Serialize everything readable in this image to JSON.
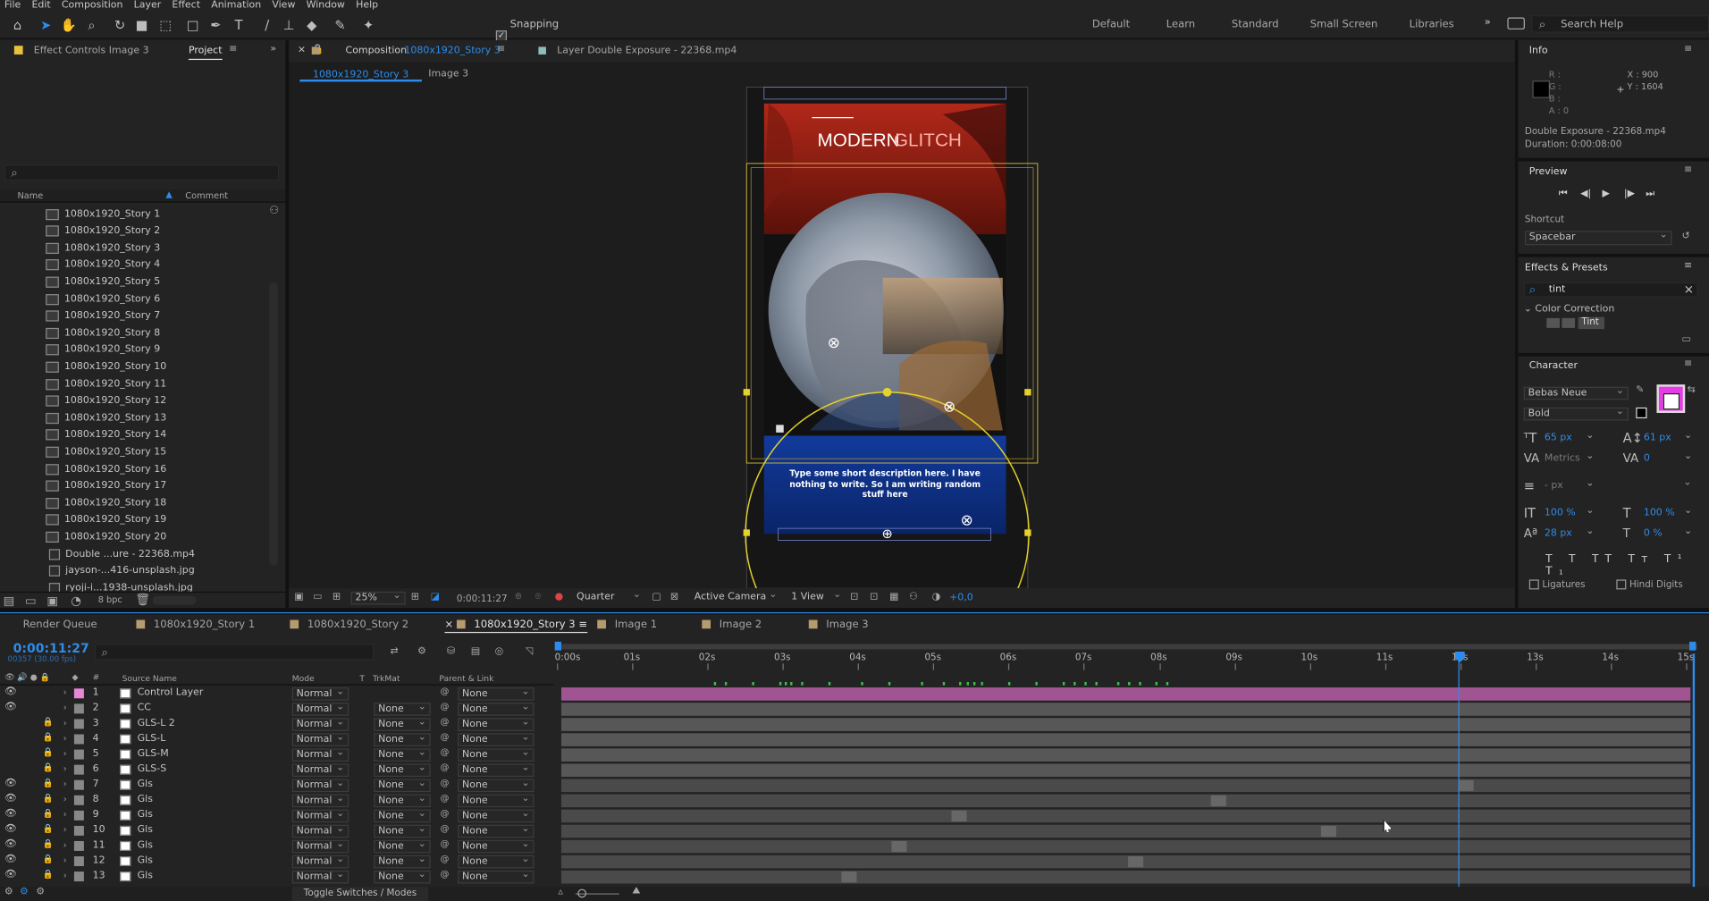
{
  "menu": [
    "File",
    "Edit",
    "Composition",
    "Layer",
    "Effect",
    "Animation",
    "View",
    "Window",
    "Help"
  ],
  "toolbar": {
    "snapping_label": "Snapping",
    "workspaces": [
      "Default",
      "Learn",
      "Standard",
      "Small Screen",
      "Libraries"
    ],
    "search_placeholder": "Search Help"
  },
  "left_panel": {
    "tab_effect_controls": "Effect Controls Image 3",
    "tab_project": "Project",
    "col_name": "Name",
    "col_comment": "Comment",
    "items": [
      "1080x1920_Story 1",
      "1080x1920_Story 2",
      "1080x1920_Story 3",
      "1080x1920_Story 4",
      "1080x1920_Story 5",
      "1080x1920_Story 6",
      "1080x1920_Story 7",
      "1080x1920_Story 8",
      "1080x1920_Story 9",
      "1080x1920_Story 10",
      "1080x1920_Story 11",
      "1080x1920_Story 12",
      "1080x1920_Story 13",
      "1080x1920_Story 14",
      "1080x1920_Story 15",
      "1080x1920_Story 16",
      "1080x1920_Story 17",
      "1080x1920_Story 18",
      "1080x1920_Story 19",
      "1080x1920_Story 20"
    ],
    "files": [
      "Double ...ure - 22368.mp4",
      "jayson-...416-unsplash.jpg",
      "ryoji-i...1938-unsplash.jpg"
    ],
    "bpc": "8 bpc"
  },
  "composition": {
    "tab_prefix": "Composition",
    "tab_name": "1080x1920_Story 3",
    "layer_tab": "Layer  Double Exposure - 22368.mp4",
    "breadcrumb_1": "1080x1920_Story 3",
    "breadcrumb_2": "Image 3",
    "title_left": "MODERN",
    "title_right": "GLITCH",
    "description": "Type some short description here. I have nothing to write. So I am writing random stuff here",
    "zoom": "25%",
    "timecode": "0:00:11:27",
    "resolution": "Quarter",
    "camera": "Active Camera",
    "views": "1 View",
    "exposure": "+0,0"
  },
  "info": {
    "title": "Info",
    "r": "R :",
    "g": "G :",
    "b": "B :",
    "a": "A :  0",
    "x": "X : 900",
    "y": "Y : 1604",
    "file": "Double Exposure - 22368.mp4",
    "duration": "Duration: 0:00:08:00"
  },
  "preview": {
    "title": "Preview",
    "shortcut_label": "Shortcut",
    "shortcut_value": "Spacebar"
  },
  "effects": {
    "title": "Effects & Presets",
    "search": "tint",
    "category": "Color Correction",
    "item": "Tint"
  },
  "character": {
    "title": "Character",
    "font": "Bebas Neue",
    "style": "Bold",
    "size": "65 px",
    "leading": "61 px",
    "kerning": "Metrics",
    "tracking": "0",
    "stroke": "- px",
    "vscale": "100 %",
    "hscale": "100 %",
    "baseline": "28 px",
    "tsume": "0 %",
    "ligatures": "Ligatures",
    "hindi": "Hindi Digits",
    "fill_color": "#e63ce6"
  },
  "timeline": {
    "tabs": [
      "Render Queue",
      "1080x1920_Story 1",
      "1080x1920_Story 2",
      "1080x1920_Story 3",
      "Image 1",
      "Image 2",
      "Image 3"
    ],
    "timecode": "0:00:11:27",
    "frames": "00357 (30.00 fps)",
    "col_source": "Source Name",
    "col_mode": "Mode",
    "col_t": "T",
    "col_trkmat": "TrkMat",
    "col_parent": "Parent & Link",
    "ruler": [
      "0:00s",
      "01s",
      "02s",
      "03s",
      "04s",
      "05s",
      "06s",
      "07s",
      "08s",
      "09s",
      "10s",
      "11s",
      "12s",
      "13s",
      "14s",
      "15s"
    ],
    "layers": [
      {
        "num": "1",
        "name": "Control Layer",
        "mode": "Normal",
        "trk": "",
        "parent": "None",
        "color": "#e887d6"
      },
      {
        "num": "2",
        "name": "CC",
        "mode": "Normal",
        "trk": "None",
        "parent": "None",
        "color": "#888888"
      },
      {
        "num": "3",
        "name": "GLS-L 2",
        "mode": "Normal",
        "trk": "None",
        "parent": "None",
        "color": "#888888"
      },
      {
        "num": "4",
        "name": "GLS-L",
        "mode": "Normal",
        "trk": "None",
        "parent": "None",
        "color": "#888888"
      },
      {
        "num": "5",
        "name": "GLS-M",
        "mode": "Normal",
        "trk": "None",
        "parent": "None",
        "color": "#888888"
      },
      {
        "num": "6",
        "name": "GLS-S",
        "mode": "Normal",
        "trk": "None",
        "parent": "None",
        "color": "#888888"
      },
      {
        "num": "7",
        "name": "Gls",
        "mode": "Normal",
        "trk": "None",
        "parent": "None",
        "color": "#888888"
      },
      {
        "num": "8",
        "name": "Gls",
        "mode": "Normal",
        "trk": "None",
        "parent": "None",
        "color": "#888888"
      },
      {
        "num": "9",
        "name": "Gls",
        "mode": "Normal",
        "trk": "None",
        "parent": "None",
        "color": "#888888"
      },
      {
        "num": "10",
        "name": "Gls",
        "mode": "Normal",
        "trk": "None",
        "parent": "None",
        "color": "#888888"
      },
      {
        "num": "11",
        "name": "Gls",
        "mode": "Normal",
        "trk": "None",
        "parent": "None",
        "color": "#888888"
      },
      {
        "num": "12",
        "name": "Gls",
        "mode": "Normal",
        "trk": "None",
        "parent": "None",
        "color": "#888888"
      },
      {
        "num": "13",
        "name": "Gls",
        "mode": "Normal",
        "trk": "None",
        "parent": "None",
        "color": "#888888"
      }
    ],
    "toggle_label": "Toggle Switches / Modes"
  }
}
